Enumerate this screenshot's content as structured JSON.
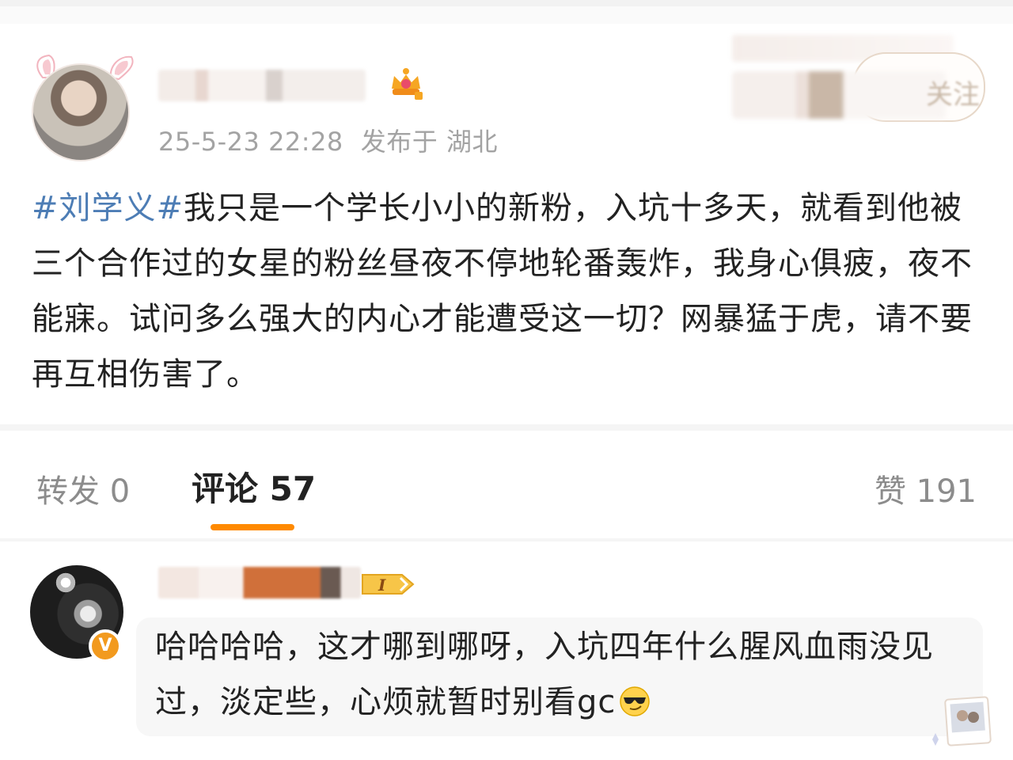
{
  "post": {
    "timestamp": "25-5-23 22:28",
    "location": "发布于 湖北",
    "hashtag": "#刘学义#",
    "body": "我只是一个学长小小的新粉，入坑十多天，就看到他被三个合作过的女星的粉丝昼夜不停地轮番轰炸，我身心俱疲，夜不能寐。试问多么强大的内心才能遭受这一切？网暴猛于虎，请不要再互相伤害了。",
    "follow_label": "关注"
  },
  "tabs": {
    "repost": "转发 0",
    "comments": "评论 57",
    "likes": "赞 191"
  },
  "comment": {
    "level_badge": "I",
    "verify_mark": "V",
    "text": "哈哈哈哈，这才哪到哪呀，入坑四年什么腥风血雨没见过，淡定些，心烦就暂时别看gc"
  },
  "colors": {
    "hashtag": "#4d7db5",
    "accent": "#ff8a00",
    "verify": "#f29a1e",
    "muted": "#a3a3a3"
  },
  "icons": [
    "bunny-ears-icon",
    "crown-icon",
    "sunglasses-emoji-icon",
    "photo-sticker-icon"
  ]
}
